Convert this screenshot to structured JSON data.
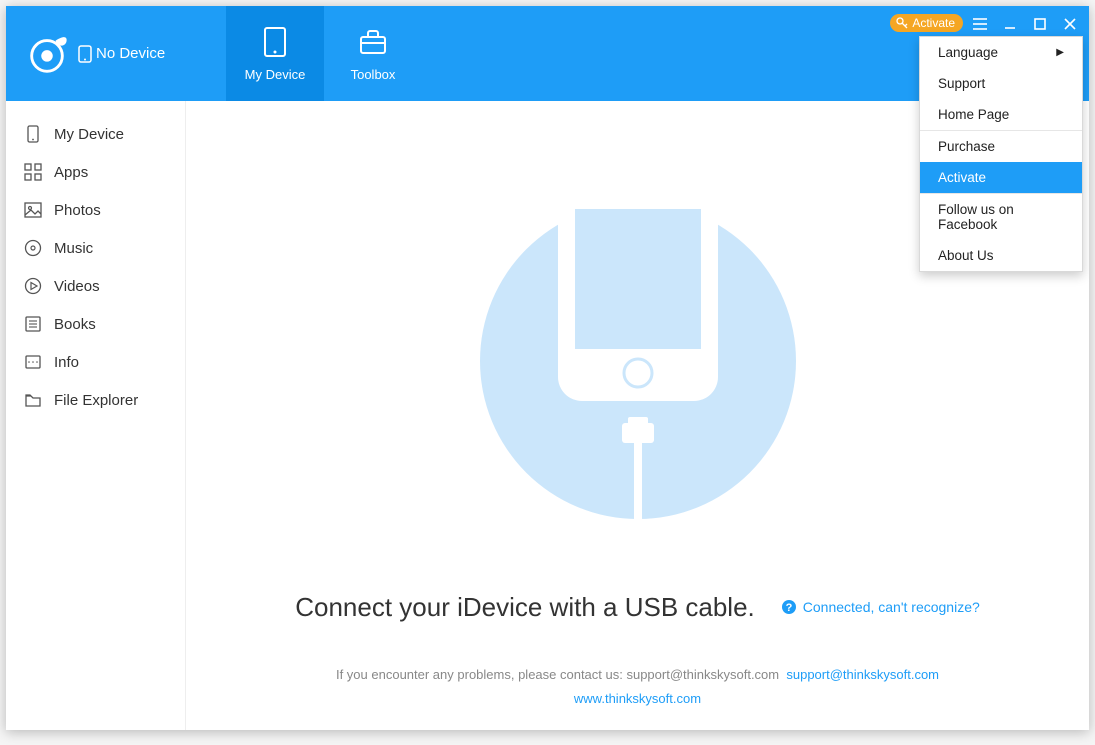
{
  "colors": {
    "primary": "#1e9df7",
    "primary_dark": "#0b8ae5",
    "accent": "#f5a623"
  },
  "header": {
    "device_status": "No Device",
    "tabs": [
      {
        "label": "My Device"
      },
      {
        "label": "Toolbox"
      }
    ],
    "activate_label": "Activate"
  },
  "sidebar": {
    "items": [
      {
        "label": "My Device"
      },
      {
        "label": "Apps"
      },
      {
        "label": "Photos"
      },
      {
        "label": "Music"
      },
      {
        "label": "Videos"
      },
      {
        "label": "Books"
      },
      {
        "label": "Info"
      },
      {
        "label": "File Explorer"
      }
    ]
  },
  "main": {
    "headline": "Connect your iDevice with a USB cable.",
    "help_link": "Connected, can't recognize?",
    "footer_prefix": "If you encounter any problems, please contact us: support@thinkskysoft.com",
    "footer_email": "support@thinkskysoft.com",
    "footer_url": "www.thinkskysoft.com"
  },
  "menu": {
    "items": [
      {
        "label": "Language",
        "submenu": true
      },
      {
        "label": "Support"
      },
      {
        "label": "Home Page"
      }
    ],
    "items2": [
      {
        "label": "Purchase"
      },
      {
        "label": "Activate",
        "highlight": true
      }
    ],
    "items3": [
      {
        "label": "Follow us on Facebook"
      },
      {
        "label": "About Us"
      }
    ]
  }
}
